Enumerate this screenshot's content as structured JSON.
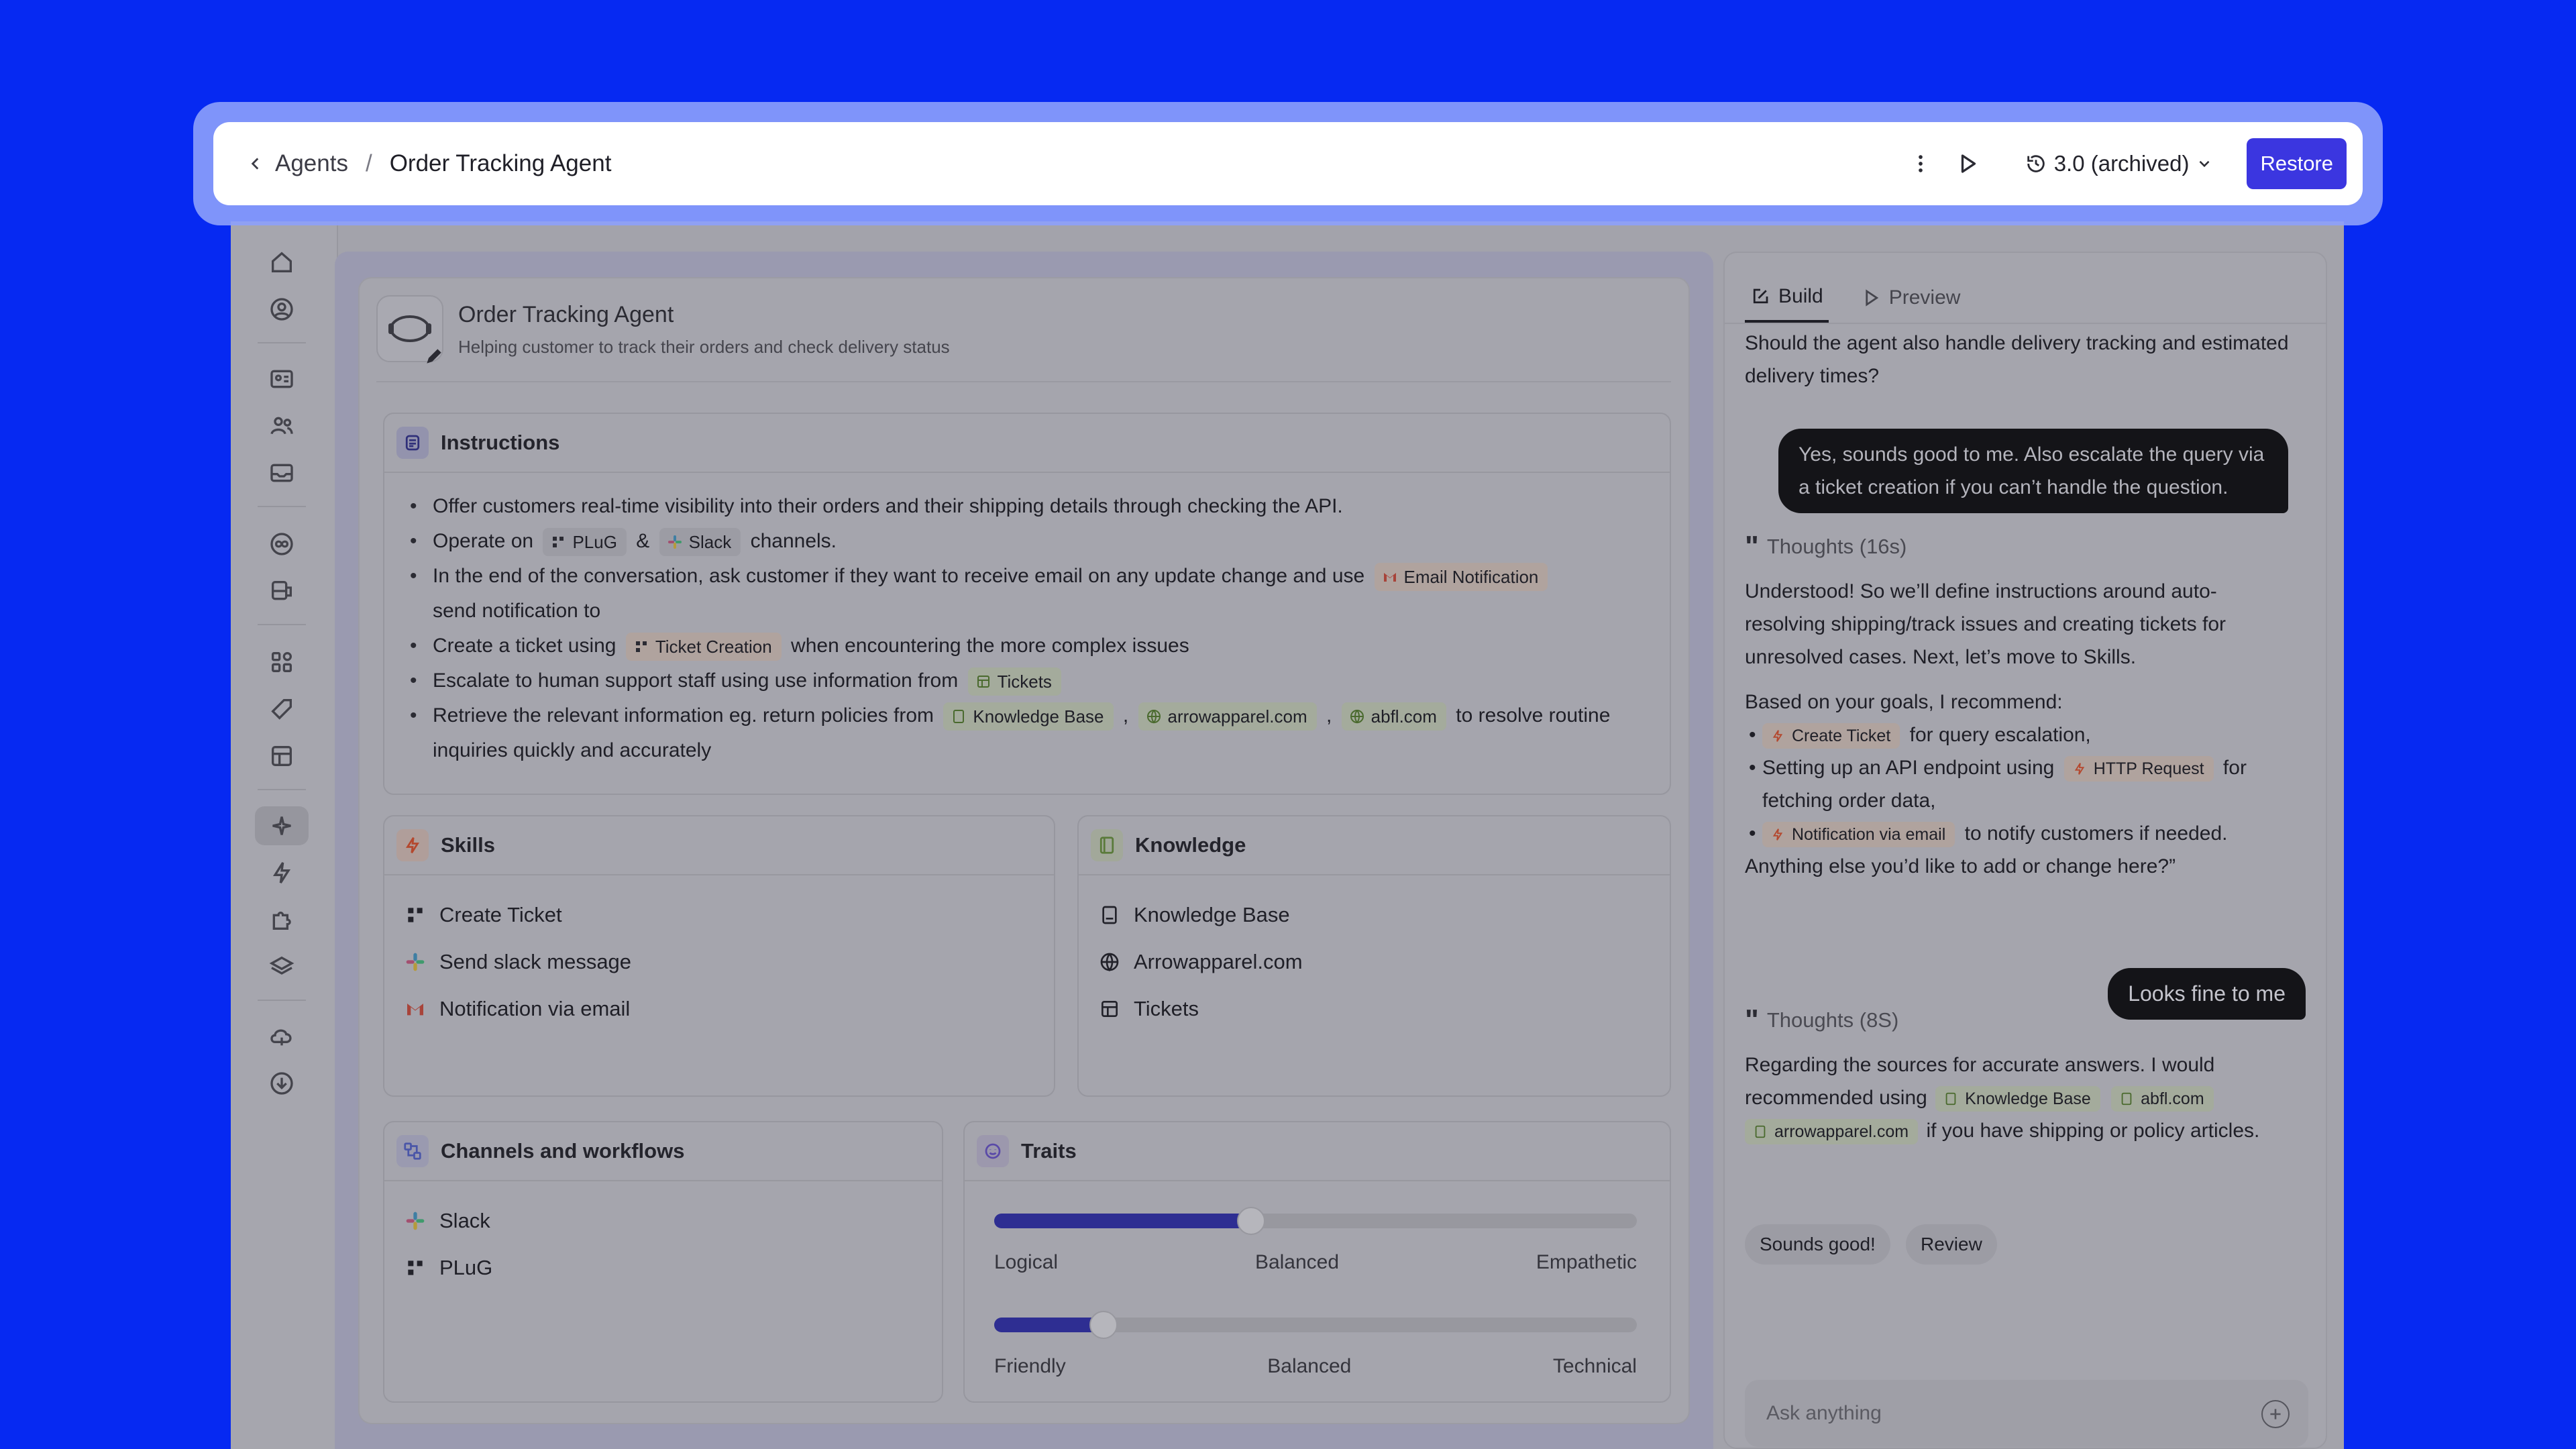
{
  "header": {
    "back_label": "Agents",
    "separator": "/",
    "current": "Order Tracking Agent",
    "version_label": "3.0 (archived)",
    "restore_label": "Restore"
  },
  "agent": {
    "name": "Order Tracking Agent",
    "description": "Helping customer to track their orders and check delivery status"
  },
  "instructions": {
    "title": "Instructions",
    "line1": "Offer customers real-time visibility into their orders and their shipping details through checking the API.",
    "line2_a": "Operate on",
    "line2_chip1": "PLuG",
    "line2_amp": "&",
    "line2_chip2": "Slack",
    "line2_b": "channels.",
    "line3_a": "In the end of the conversation, ask customer if they want to receive email on any update change and use",
    "line3_chip": "Email Notification",
    "line3_b": "send notification to",
    "line4_a": "Create a ticket using",
    "line4_chip": "Ticket Creation",
    "line4_b": "when encountering the more complex issues",
    "line5_a": "Escalate to human support staff using use information from",
    "line5_chip": "Tickets",
    "line6_a": "Retrieve the relevant information eg. return policies from",
    "line6_chip1": "Knowledge Base",
    "line6_comma": ",",
    "line6_chip2": "arrowapparel.com",
    "line6_chip3": "abfl.com",
    "line6_b": "to resolve routine inquiries quickly and accurately"
  },
  "skills": {
    "title": "Skills",
    "items": [
      "Create Ticket",
      "Send slack message",
      "Notification via email"
    ]
  },
  "knowledge": {
    "title": "Knowledge",
    "items": [
      "Knowledge Base",
      "Arrowapparel.com",
      "Tickets"
    ]
  },
  "channels": {
    "title": "Channels and workflows",
    "items": [
      "Slack",
      "PLuG"
    ]
  },
  "traits": {
    "title": "Traits",
    "slider1": {
      "left": "Logical",
      "mid": "Balanced",
      "right": "Empathetic",
      "value": 0.4
    },
    "slider2": {
      "left": "Friendly",
      "mid": "Balanced",
      "right": "Technical",
      "value": 0.17
    }
  },
  "chat": {
    "tabs": [
      "Build",
      "Preview"
    ],
    "intro": "Should the agent also handle delivery tracking and estimated delivery times?",
    "user_msg1": "Yes, sounds good to me. Also escalate the query via a ticket creation if you can’t handle the question.",
    "thought1": "Thoughts (16s)",
    "reply1": "Understood! So we’ll define instructions around auto-resolving shipping/track issues and creating tickets for unresolved cases. Next, let’s move to Skills.",
    "rec_intro": "Based on your goals, I recommend:",
    "rec1_chip": "Create Ticket",
    "rec1_text": "for query escalation,",
    "rec2_a": "Setting up an API endpoint using",
    "rec2_chip": "HTTP Request",
    "rec2_b": "for fetching order data,",
    "rec3_chip": "Notification via email",
    "rec3_text": "to notify customers if needed.",
    "rec_outro": "Anything else you’d like to add or change here?”",
    "user_msg2": "Looks fine to me",
    "thought2": "Thoughts (8S)",
    "reply2_a": "Regarding the sources for accurate answers. I would recommended using",
    "reply2_chip1": "Knowledge Base",
    "reply2_chip2": "abfl.com",
    "reply2_chip3": "arrowapparel.com",
    "reply2_b": "if you have shipping or policy articles.",
    "suggestion1": "Sounds good!",
    "suggestion2": "Review",
    "input_placeholder": "Ask anything"
  }
}
